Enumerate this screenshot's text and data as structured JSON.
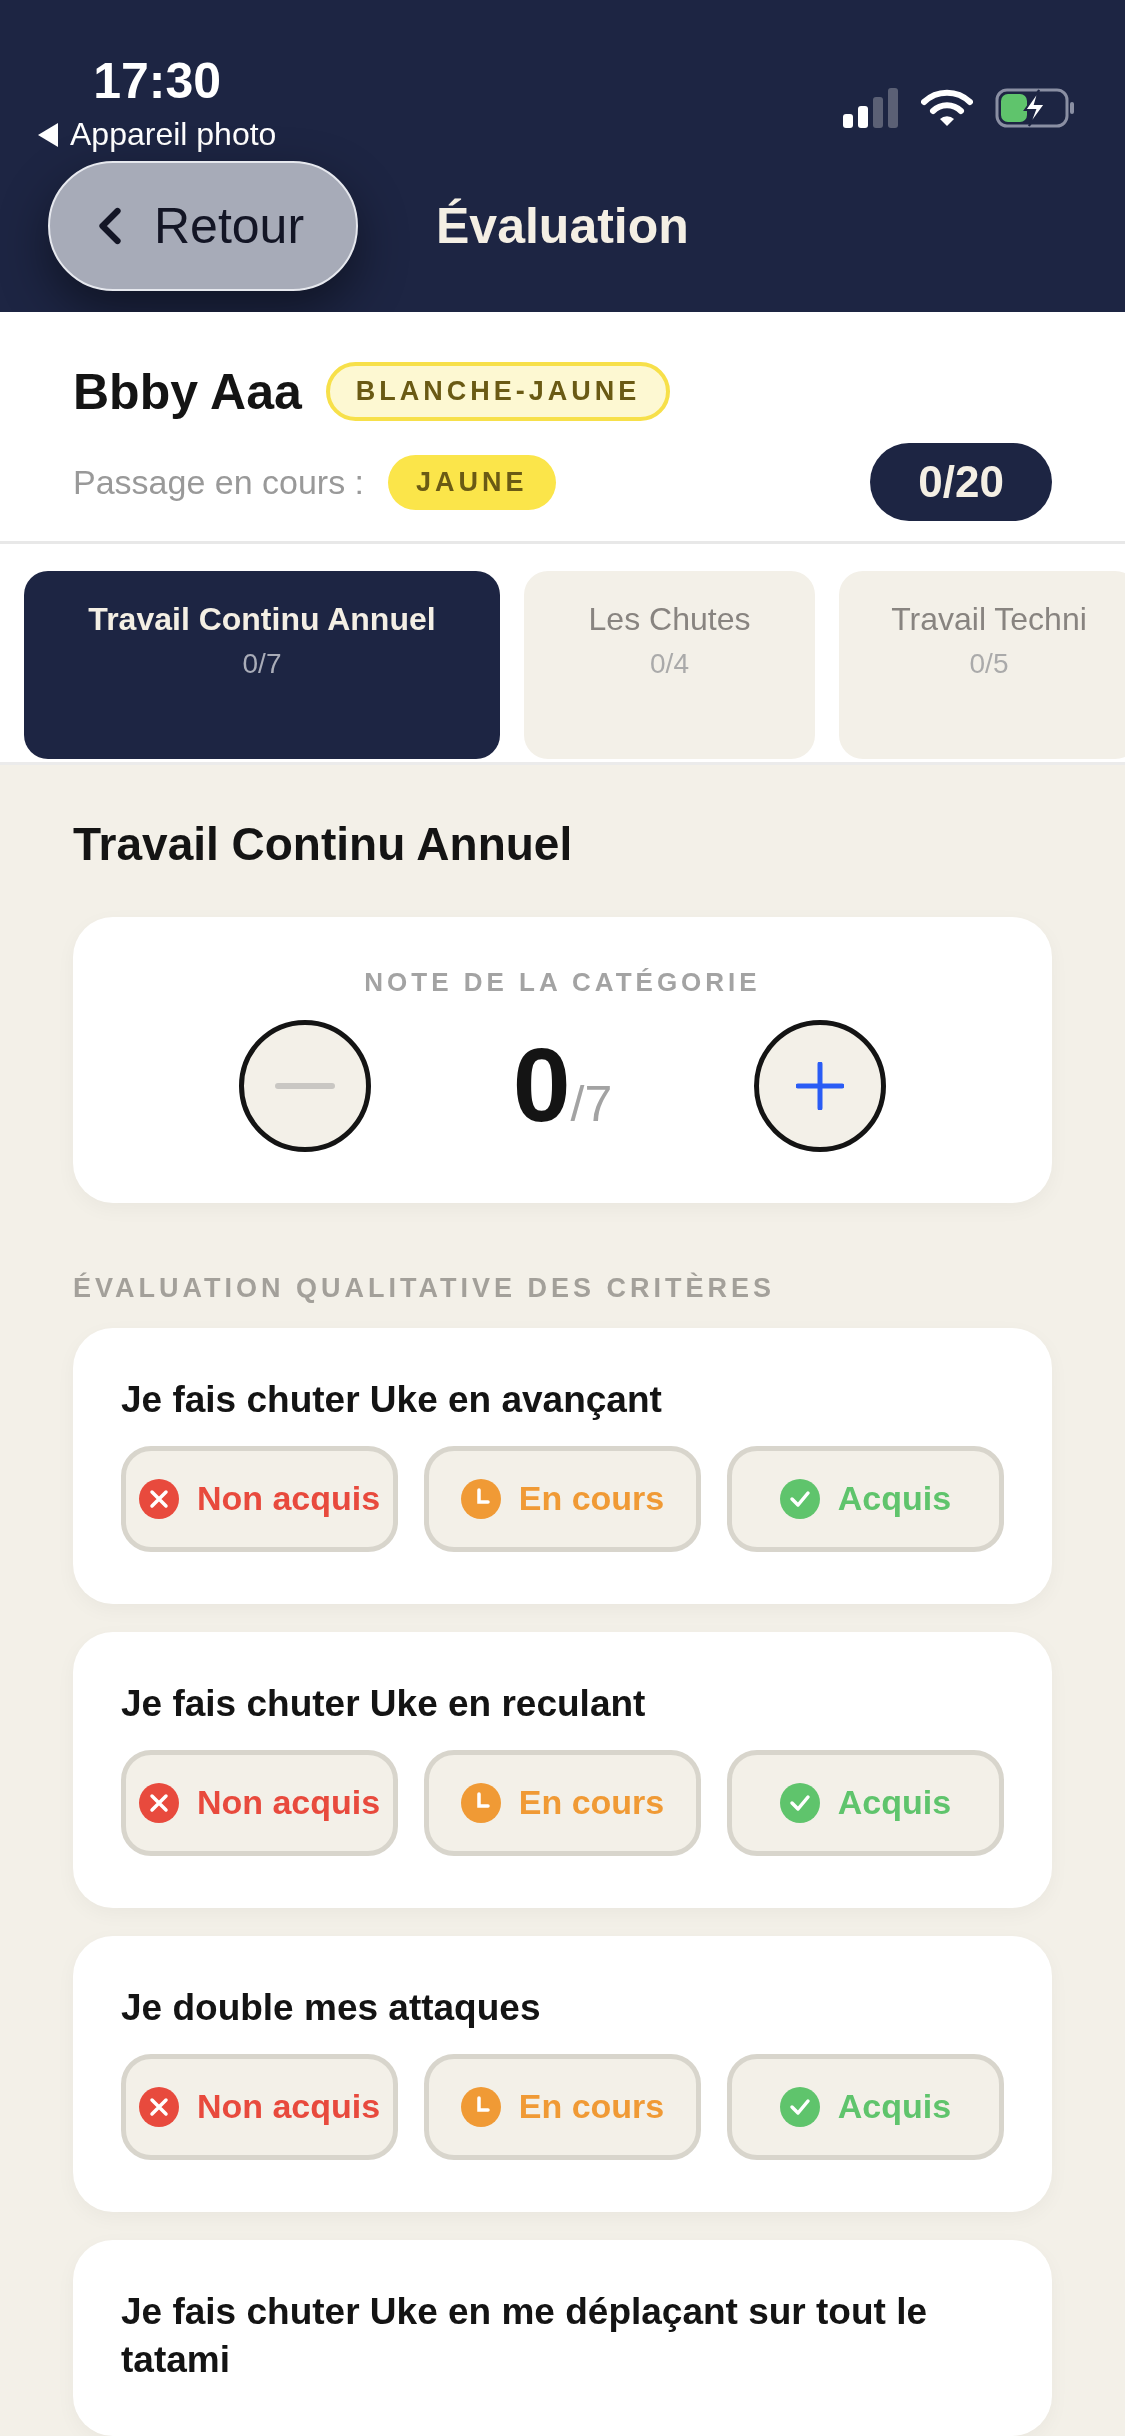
{
  "status_bar": {
    "time": "17:30",
    "back_app": "Appareil photo"
  },
  "nav": {
    "back_label": "Retour",
    "title": "Évaluation"
  },
  "student": {
    "name": "Bbby Aaa",
    "belt": "BLANCHE-JAUNE",
    "passage_label": "Passage en cours :",
    "passage_belt": "JAUNE",
    "total_score": "0/20"
  },
  "tabs": [
    {
      "label": "Travail Continu Annuel",
      "score": "0/7",
      "selected": true
    },
    {
      "label": "Les Chutes",
      "score": "0/4",
      "selected": false
    },
    {
      "label": "Travail Techni",
      "score": "0/5",
      "selected": false
    }
  ],
  "section_title": "Travail Continu Annuel",
  "grade": {
    "label": "NOTE DE LA CATÉGORIE",
    "value": "0",
    "max": "/7",
    "decrement_disabled": true,
    "increment_disabled": false
  },
  "criteria_heading": "ÉVALUATION QUALITATIVE DES CRITÈRES",
  "criteria": [
    {
      "title": "Je fais chuter Uke en avançant",
      "options": [
        {
          "kind": "not_acquired",
          "label": "Non acquis",
          "selected": false
        },
        {
          "kind": "in_progress",
          "label": "En cours",
          "selected": false
        },
        {
          "kind": "acquired",
          "label": "Acquis",
          "selected": false
        }
      ]
    },
    {
      "title": "Je fais chuter Uke en reculant",
      "options": [
        {
          "kind": "not_acquired",
          "label": "Non acquis",
          "selected": false
        },
        {
          "kind": "in_progress",
          "label": "En cours",
          "selected": false
        },
        {
          "kind": "acquired",
          "label": "Acquis",
          "selected": false
        }
      ]
    },
    {
      "title": "Je double mes attaques",
      "options": [
        {
          "kind": "not_acquired",
          "label": "Non acquis",
          "selected": false
        },
        {
          "kind": "in_progress",
          "label": "En cours",
          "selected": false
        },
        {
          "kind": "acquired",
          "label": "Acquis",
          "selected": false
        }
      ]
    },
    {
      "title": "Je fais chuter Uke en me déplaçant sur tout le tatami"
    }
  ]
}
